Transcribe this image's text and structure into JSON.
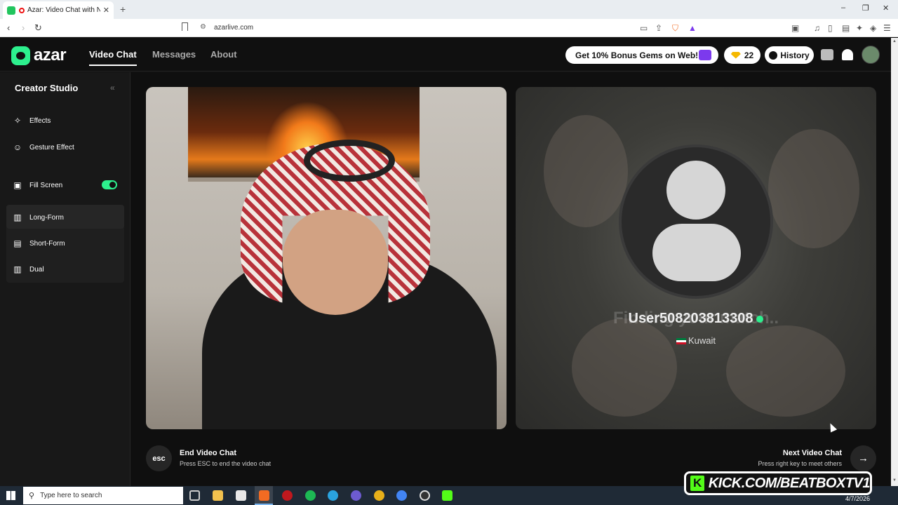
{
  "browser": {
    "tab_title": "Azar: Video Chat with New Pe",
    "url": "azarlive.com",
    "new_tab": "+",
    "win_minimize": "–",
    "win_restore": "❐",
    "win_close": "✕"
  },
  "app": {
    "logo_text": "azar",
    "nav": [
      "Video Chat",
      "Messages",
      "About"
    ],
    "promo": "Get 10% Bonus Gems on Web!",
    "gems": "22",
    "history": "History"
  },
  "sidebar": {
    "title": "Creator Studio",
    "collapse": "«",
    "effects": "Effects",
    "gesture": "Gesture Effect",
    "fill_screen": "Fill Screen",
    "fill_screen_on": true,
    "layouts": [
      "Long-Form",
      "Short-Form",
      "Dual"
    ]
  },
  "partner": {
    "finding": "Finding your match..",
    "username": "User508203813308",
    "country": "Kuwait"
  },
  "controls": {
    "esc_key": "esc",
    "end_title": "End Video Chat",
    "end_sub": "Press ESC to end the video chat",
    "next_title": "Next Video Chat",
    "next_sub": "Press right key to meet others",
    "next_arrow": "→"
  },
  "watermark": "KICK.COM/BEATBOXTV1",
  "taskbar": {
    "search_placeholder": "Type here to search",
    "date": "4/7/2026"
  },
  "colors": {
    "accent": "#2df08e",
    "background": "#111111",
    "kick_green": "#53fc18"
  }
}
